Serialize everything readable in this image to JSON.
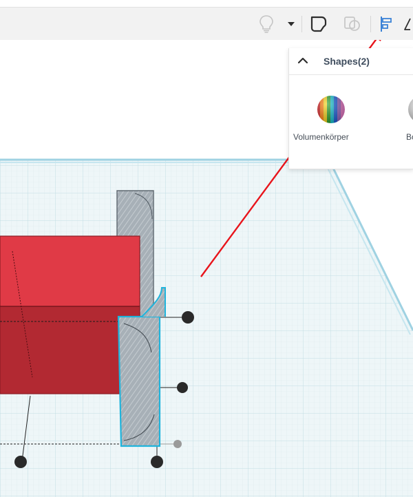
{
  "panel": {
    "title": "Shapes",
    "count": "(2)",
    "items": [
      {
        "label": "Volumenkörper",
        "icon": "rainbow-sphere-icon"
      },
      {
        "label": "Bo",
        "icon": "gray-sphere-icon"
      }
    ]
  },
  "toolbar": {
    "icons": [
      "lightbulb-icon",
      "chevron-down-icon",
      "group-shape-icon",
      "ungroup-shape-icon",
      "align-icon",
      "mirror-icon"
    ]
  },
  "colors": {
    "accent": "#3b82d6",
    "annotation_arrow": "#e8141b",
    "red_shape": "#e03a46",
    "grid_line": "#cfe3e8",
    "selection": "#1fb4dc"
  }
}
